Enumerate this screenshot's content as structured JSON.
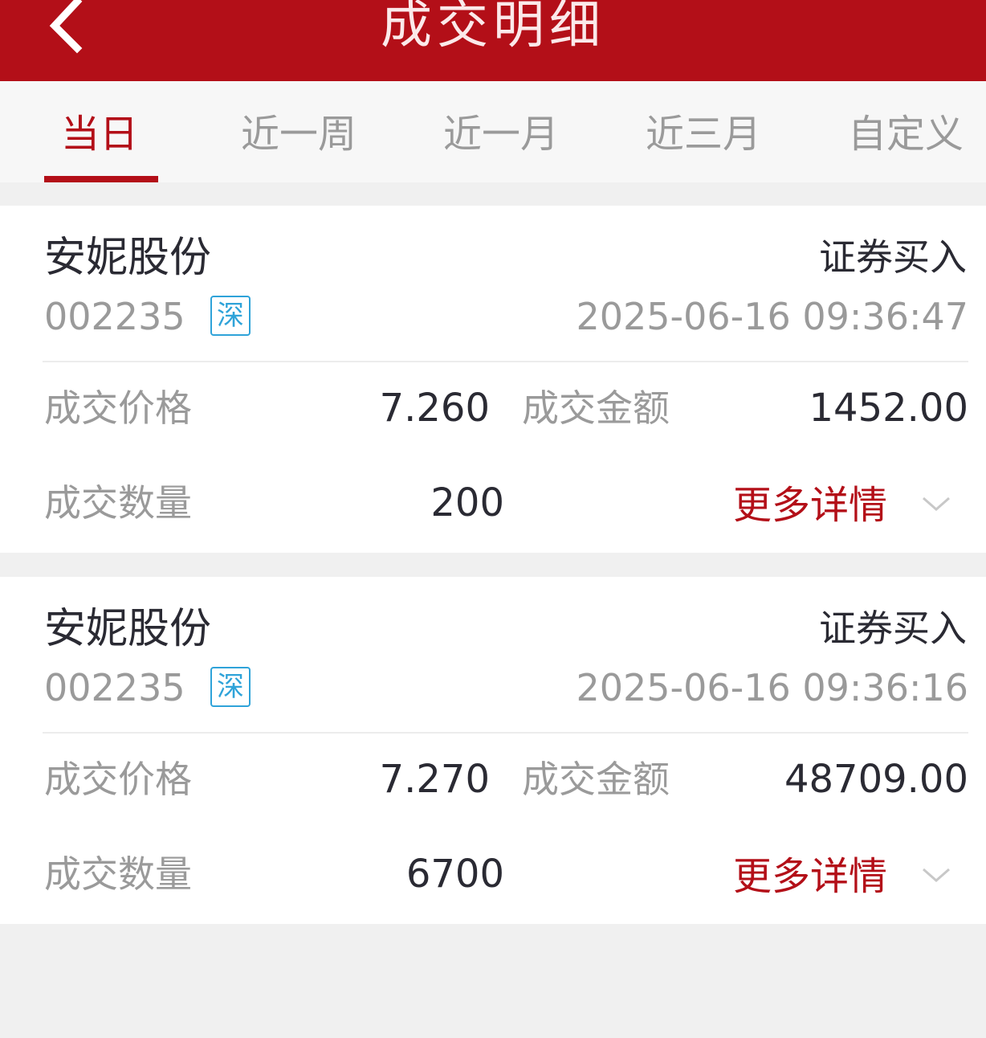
{
  "header": {
    "title": "成交明细",
    "back_icon": "chevron-left-icon"
  },
  "tabs": [
    {
      "label": "当日",
      "active": true
    },
    {
      "label": "近一周",
      "active": false
    },
    {
      "label": "近一月",
      "active": false
    },
    {
      "label": "近三月",
      "active": false
    },
    {
      "label": "自定义",
      "active": false
    }
  ],
  "trades": [
    {
      "name": "安妮股份",
      "type": "证券买入",
      "code": "002235",
      "market": "深",
      "time": "2025-06-16 09:36:47",
      "price_label": "成交价格",
      "price": "7.260",
      "amount_label": "成交金额",
      "amount": "1452.00",
      "qty_label": "成交数量",
      "qty": "200",
      "more": "更多详情"
    },
    {
      "name": "安妮股份",
      "type": "证券买入",
      "code": "002235",
      "market": "深",
      "time": "2025-06-16 09:36:16",
      "price_label": "成交价格",
      "price": "7.270",
      "amount_label": "成交金额",
      "amount": "48709.00",
      "qty_label": "成交数量",
      "qty": "6700",
      "more": "更多详情"
    }
  ],
  "colors": {
    "brand": "#b30f18",
    "market_badge": "#2fa3d9",
    "muted_text": "#9a9a9a",
    "primary_text": "#2a2a33"
  }
}
